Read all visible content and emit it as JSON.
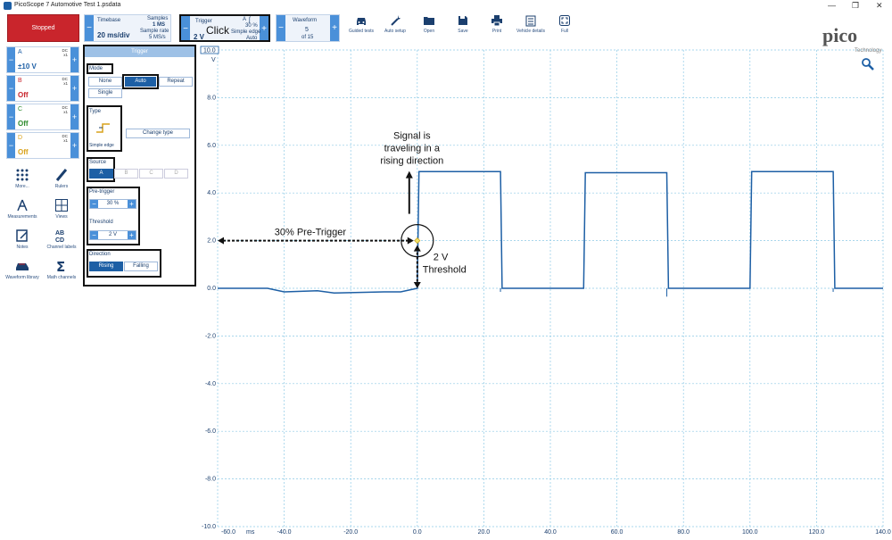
{
  "window": {
    "title": "PicoScope 7 Automotive Test 1.psdata",
    "minimize": "—",
    "restore": "❐",
    "close": "✕"
  },
  "toolbar": {
    "status": "Stopped",
    "timebase": {
      "label": "Timebase",
      "value": "20 ms/div",
      "samples_label": "Samples",
      "samples_value": "1 MS",
      "rate_label": "Sample rate",
      "rate_value": "5 MS/s"
    },
    "trigger": {
      "label": "Trigger",
      "value": "2 V",
      "pretrigger": "30 %",
      "type": "Simple edge",
      "mode": "Auto",
      "channel": "A"
    },
    "click_annotation": "Click",
    "waveform": {
      "label": "Waveform",
      "value": "5",
      "of": "of 15"
    },
    "tools": [
      {
        "label": "Guided tests",
        "icon": "car-icon"
      },
      {
        "label": "Auto setup",
        "icon": "wand-icon"
      },
      {
        "label": "Open",
        "icon": "folder-icon"
      },
      {
        "label": "Save",
        "icon": "save-icon"
      },
      {
        "label": "Print",
        "icon": "printer-icon"
      },
      {
        "label": "Vehicle details",
        "icon": "clipboard-icon"
      },
      {
        "label": "Full",
        "icon": "fullscreen-icon"
      }
    ],
    "logo": {
      "text": "pico",
      "sub": "Technology"
    }
  },
  "channels": [
    {
      "name": "A",
      "color": "#1d5fa5",
      "coupling": "DC",
      "probe": "x1",
      "range": "±10 V"
    },
    {
      "name": "B",
      "color": "#c9252c",
      "coupling": "DC",
      "probe": "x1",
      "range": "Off"
    },
    {
      "name": "C",
      "color": "#2e8b2e",
      "coupling": "DC",
      "probe": "x1",
      "range": "Off"
    },
    {
      "name": "D",
      "color": "#d9a21b",
      "coupling": "DC",
      "probe": "x1",
      "range": "Off"
    }
  ],
  "side_tools": [
    "More...",
    "Rulers",
    "Measurements",
    "Views",
    "Notes",
    "Channel labels",
    "Waveform library",
    "Math channels"
  ],
  "trigger_panel": {
    "header": "Trigger",
    "mode_label": "Mode",
    "modes": [
      "None",
      "Auto",
      "Repeat",
      "Single"
    ],
    "mode_selected": "Auto",
    "type_label": "Type",
    "type_value": "Simple edge",
    "change_type": "Change type",
    "source_label": "Source",
    "sources": [
      "A",
      "B",
      "C",
      "D"
    ],
    "source_selected": "A",
    "pretrigger_label": "Pre-trigger",
    "pretrigger_value": "30 %",
    "threshold_label": "Threshold",
    "threshold_value": "2 V",
    "direction_label": "Direction",
    "directions": [
      "Rising",
      "Falling"
    ],
    "direction_selected": "Rising"
  },
  "plot": {
    "unit_box": "10.0",
    "unit": "V",
    "y_ticks": [
      "8.0",
      "6.0",
      "4.0",
      "2.0",
      "0.0",
      "-2.0",
      "-4.0",
      "-6.0",
      "-8.0",
      "-10.0"
    ],
    "x_ticks": [
      "-60.0",
      "-40.0",
      "-20.0",
      "0.0",
      "20.0",
      "40.0",
      "60.0",
      "80.0",
      "100.0",
      "120.0",
      "140.0"
    ],
    "x_unit": "ms",
    "trace_color": "#1d5fa5",
    "annotations": {
      "signal": [
        "Signal is",
        "traveling in a",
        "rising direction"
      ],
      "pretrigger": "30% Pre-Trigger",
      "threshold": [
        "2 V",
        "Threshold"
      ]
    }
  },
  "chart_data": {
    "type": "line",
    "xlabel": "ms",
    "ylabel": "V",
    "xlim": [
      -60,
      140
    ],
    "ylim": [
      -10,
      10
    ],
    "grid": true,
    "series": [
      {
        "name": "A",
        "x": [
          -60,
          -45,
          -40,
          -30,
          -25,
          -10,
          -5,
          0,
          0.5,
          25,
          25.5,
          50,
          50.5,
          75,
          75.5,
          100,
          100.5,
          125,
          125.5,
          140
        ],
        "y": [
          0.0,
          0.0,
          -0.15,
          -0.1,
          -0.2,
          -0.15,
          -0.15,
          0.0,
          4.9,
          4.9,
          0.0,
          0.0,
          4.85,
          4.85,
          0.0,
          0.0,
          4.9,
          4.9,
          0.0,
          0.0
        ]
      }
    ],
    "trigger": {
      "x": 0,
      "y": 2
    }
  }
}
